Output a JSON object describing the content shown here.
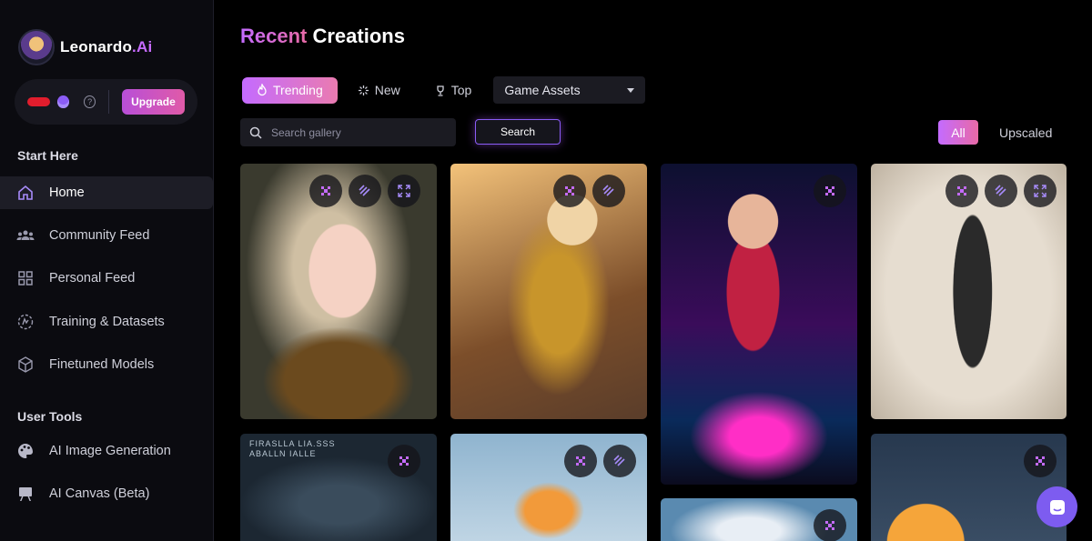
{
  "brand": {
    "name_main": "Leonardo",
    "name_suffix": ".Ai"
  },
  "account": {
    "upgrade_label": "Upgrade",
    "help_icon": "question-circle-icon",
    "token_icon": "coins-icon"
  },
  "sidebar": {
    "section_start": "Start Here",
    "start_items": [
      {
        "label": "Home",
        "icon": "home-icon",
        "active": true
      },
      {
        "label": "Community Feed",
        "icon": "community-icon"
      },
      {
        "label": "Personal Feed",
        "icon": "grid-icon"
      },
      {
        "label": "Training & Datasets",
        "icon": "training-icon"
      },
      {
        "label": "Finetuned Models",
        "icon": "cube-icon"
      }
    ],
    "section_tools": "User Tools",
    "tool_items": [
      {
        "label": "AI Image Generation",
        "icon": "palette-icon"
      },
      {
        "label": "AI Canvas (Beta)",
        "icon": "easel-icon"
      }
    ]
  },
  "header": {
    "title_accent": "Recent",
    "title_rest": " Creations"
  },
  "filters": {
    "chips": [
      {
        "label": "Trending",
        "icon": "flame-icon",
        "active": true
      },
      {
        "label": "New",
        "icon": "sparkle-icon"
      },
      {
        "label": "Top",
        "icon": "trophy-icon"
      }
    ],
    "category_selected": "Game Assets"
  },
  "search": {
    "placeholder": "Search gallery",
    "value": "",
    "button_label": "Search"
  },
  "view_toggle": {
    "all_label": "All",
    "upscaled_label": "Upscaled"
  },
  "gallery": {
    "card5_caption": "FIRASLLA LIA.SSS\nABALLN IALLE"
  },
  "colors": {
    "accent_start": "#c46bff",
    "accent_end": "#e86aa6",
    "background": "#000000"
  }
}
